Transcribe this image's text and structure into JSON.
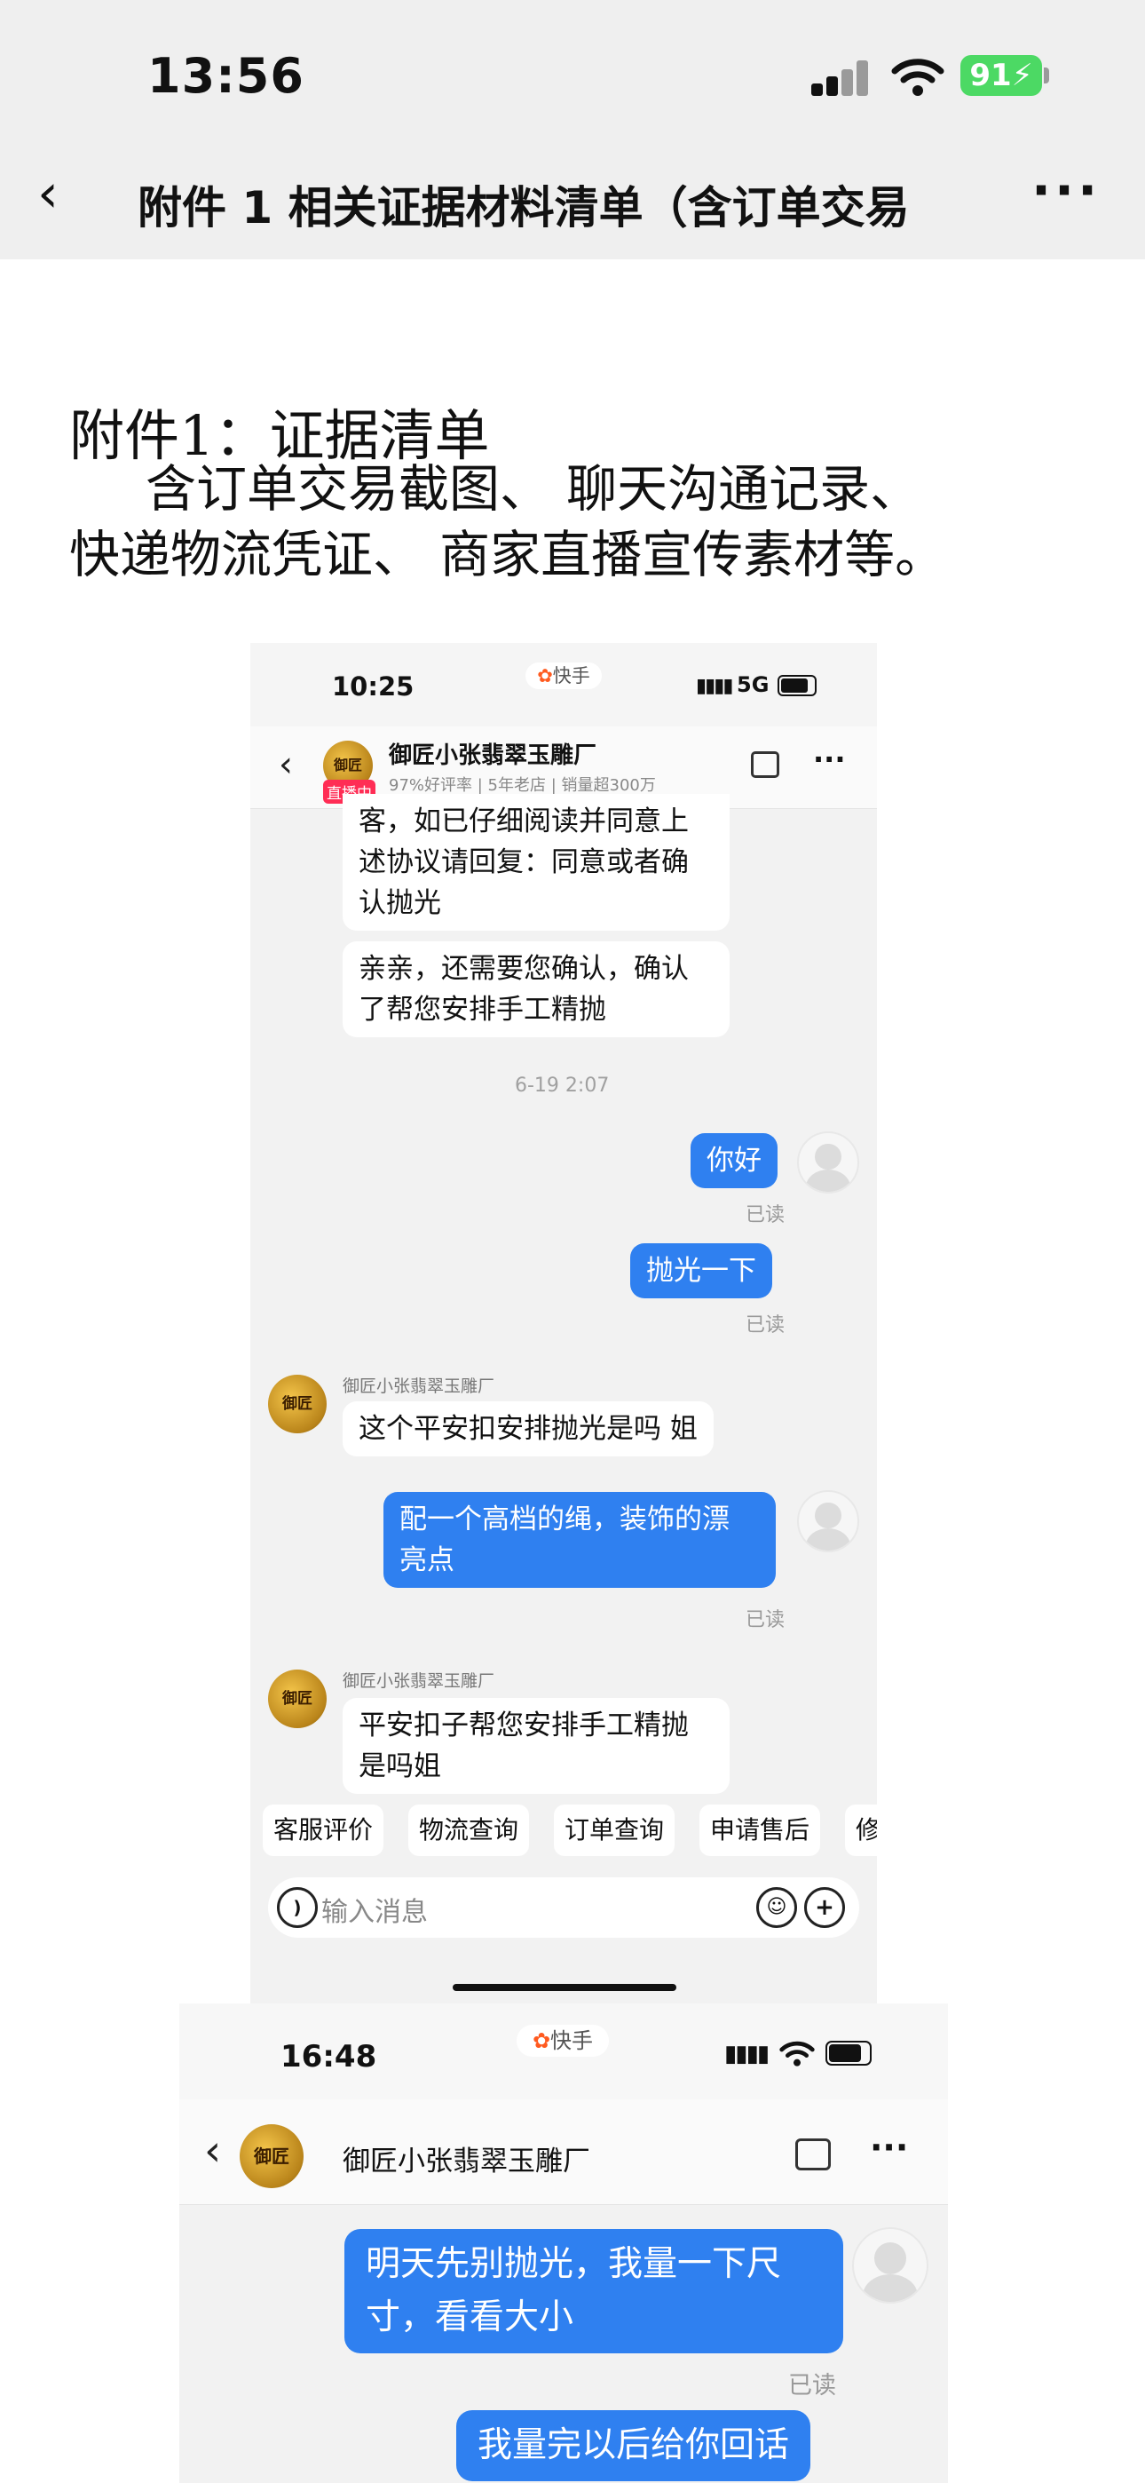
{
  "status_bar": {
    "time": "13:56",
    "battery": "91"
  },
  "nav": {
    "back_glyph": "‹",
    "title": "附件 1 相关证据材料清单（含订单交易",
    "more_glyph": "···"
  },
  "document": {
    "heading": "附件1：证据清单",
    "paragraph_line1": "含订单交易截图、 聊天沟通记录、",
    "paragraph_line2": "快递物流凭证、 商家直播宣传素材等。"
  },
  "screenshot1": {
    "time": "10:25",
    "app_pill": "快手",
    "network": "5G",
    "shop": {
      "name": "御匠小张翡翠玉雕厂",
      "live_badge": "直播中",
      "rating": "97%好评率",
      "age": "5年老店",
      "sales": "销量超300万",
      "avatar_text": "御匠"
    },
    "messages": {
      "m1_line1": "客，如已仔细阅读并同意上",
      "m1_line2": "述协议请回复：同意或者确",
      "m1_line3": "认抛光",
      "m2_line1": "亲亲，还需要您确认，确认",
      "m2_line2": "了帮您安排手工精抛",
      "timestamp": "6-19 2:07",
      "m3": "你好",
      "m4": "抛光一下",
      "read": "已读",
      "sender": "御匠小张翡翠玉雕厂",
      "m5": "这个平安扣安排抛光是吗 姐",
      "m6_line1": "配一个高档的绳，装饰的漂",
      "m6_line2": "亮点",
      "m7_line1": "平安扣子帮您安排手工精抛",
      "m7_line2": "是吗姐"
    },
    "quick_replies": [
      "客服评价",
      "物流查询",
      "订单查询",
      "申请售后",
      "修"
    ],
    "input_placeholder": "输入消息"
  },
  "screenshot2": {
    "time": "16:48",
    "app_pill": "快手",
    "shop_name": "御匠小张翡翠玉雕厂",
    "avatar_text": "御匠",
    "m1_line1": "明天先别抛光，我量一下尺",
    "m1_line2": "寸，看看大小",
    "read": "已读",
    "m2": "我量完以后给你回话"
  },
  "colors": {
    "bubble_blue": "#2f80f0",
    "battery_green": "#4cd964",
    "live_red": "#ff2d55",
    "kuaishou_orange": "#ff5a1f"
  }
}
